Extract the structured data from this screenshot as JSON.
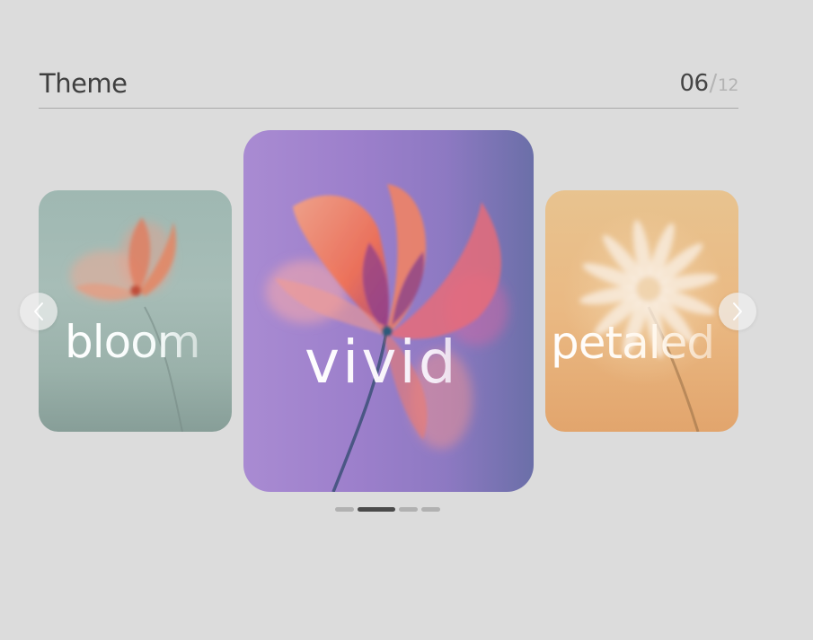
{
  "header": {
    "title": "Theme",
    "current": "06",
    "separator": "/",
    "total": "12"
  },
  "cards": [
    {
      "label": "bloom",
      "theme": "teal-flower"
    },
    {
      "label": "vivid",
      "theme": "violet-flower"
    },
    {
      "label": "petaled",
      "theme": "peach-flower"
    }
  ],
  "navigation": {
    "prev_icon": "chevron-left-icon",
    "next_icon": "chevron-right-icon"
  },
  "pagination": {
    "dot_count": 4,
    "active_index": 1
  },
  "colors": {
    "background": "#dcdcdc",
    "title": "#3f3f3f",
    "active_dot": "#4a4a4a",
    "inactive_dot": "#b1b1b1"
  }
}
